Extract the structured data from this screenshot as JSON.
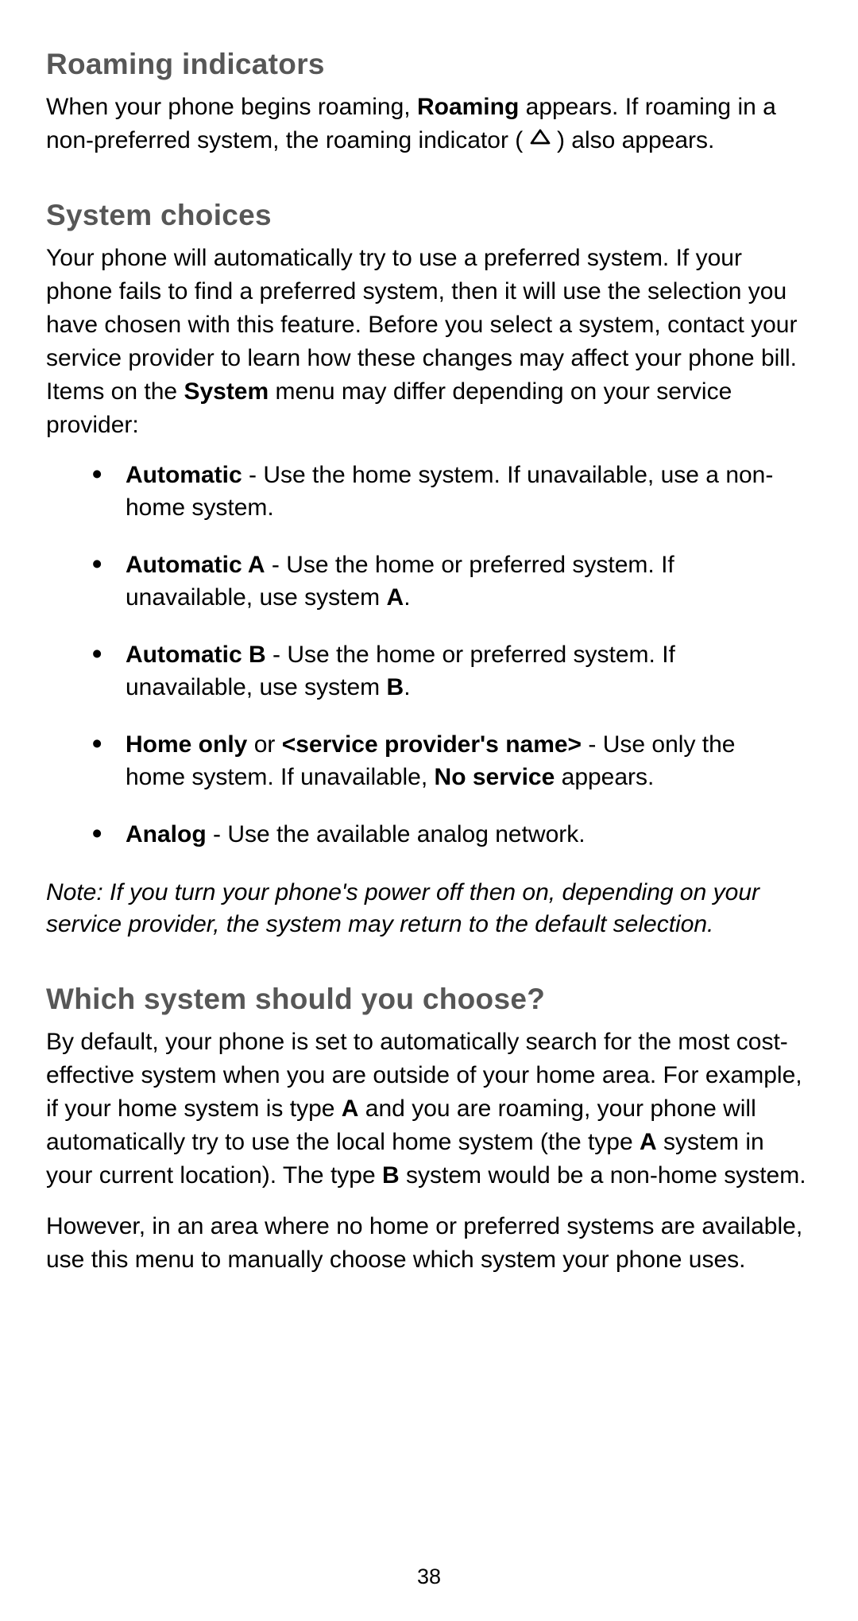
{
  "page_number": 38,
  "sections": {
    "roaming_indicators": {
      "title": "Roaming indicators",
      "p1_part1": "When your phone begins roaming, ",
      "p1_bold1": "Roaming",
      "p1_part2": " appears. If roaming in a non-preferred system, the roaming indicator ( ",
      "p1_part3": " ) also appears."
    },
    "system_choices": {
      "title": "System choices",
      "p1_part1": "Your phone will automatically try to use a preferred system. If your phone fails to find a preferred system, then it will use the selection you have chosen with this feature. Before you select a system, contact your service provider to learn how these changes may affect your phone bill. Items on the ",
      "p1_bold1": "System",
      "p1_part2": " menu may differ depending on your service provider:",
      "bullets": {
        "b1": {
          "bold": "Automatic",
          "rest": " - Use the home system. If unavailable, use a non-home system."
        },
        "b2": {
          "bold": "Automatic A",
          "rest1": " - Use the home or preferred system. If unavailable, use system ",
          "boldA": "A",
          "rest2": "."
        },
        "b3": {
          "bold": "Automatic B",
          "rest1": " - Use the home or preferred system. If unavailable, use system ",
          "boldB": "B",
          "rest2": "."
        },
        "b4": {
          "bold1": "Home only",
          "mid1": " or ",
          "bold2": "<service provider's name>",
          "mid2": " - Use only the home system. If unavailable, ",
          "bold3": "No service",
          "rest": " appears."
        },
        "b5": {
          "bold": "Analog",
          "rest": " - Use the available analog network."
        }
      },
      "note": "Note: If you turn your phone's power off then on, depending on your service provider, the system may return to the default selection."
    },
    "which_system": {
      "title": "Which system should you choose?",
      "p1_part1": "By default, your phone is set to automatically search for the most cost-effective system when you are outside of your home area. For example, if your home system is type ",
      "p1_boldA": "A",
      "p1_part2": " and you are roaming, your phone will automatically try to use the local home system (the type ",
      "p1_boldA2": "A",
      "p1_part3": " system in your current location). The type ",
      "p1_boldB": "B",
      "p1_part4": " system would be a non-home system.",
      "p2": "However, in an area where no home or preferred systems are available, use this menu to manually choose which system your phone uses."
    }
  }
}
